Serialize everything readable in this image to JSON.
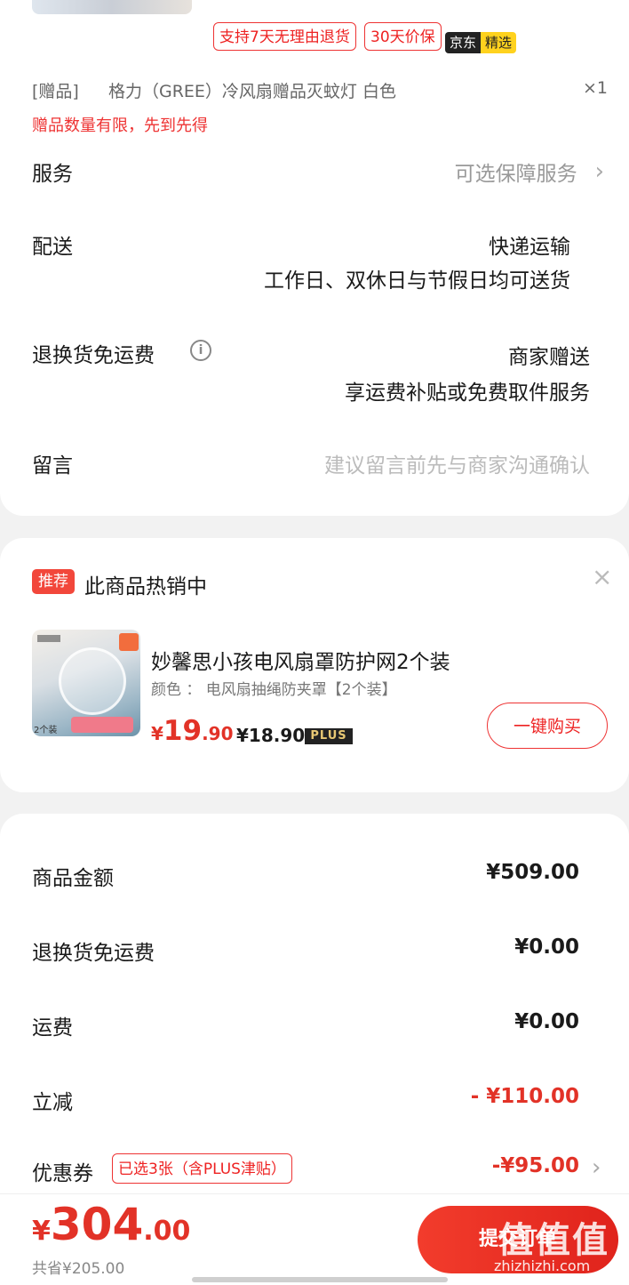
{
  "product": {
    "tags": [
      "支持7天无理由退货",
      "30天价保"
    ],
    "jd_badge": {
      "part1": "京东",
      "part2": "精选"
    },
    "gift": {
      "prefix": "[赠品]",
      "name": "格力（GREE）冷风扇赠品灭蚊灯  白色",
      "qty": "×1",
      "note": "赠品数量有限，先到先得"
    }
  },
  "rows": {
    "service": {
      "label": "服务",
      "value": "可选保障服务"
    },
    "delivery": {
      "label": "配送",
      "value": "快递运输",
      "sub": "工作日、双休日与节假日均可送货"
    },
    "return_freight": {
      "label": "退换货免运费",
      "value": "商家赠送",
      "sub": "享运费补贴或免费取件服务"
    },
    "message": {
      "label": "留言",
      "placeholder": "建议留言前先与商家沟通确认"
    }
  },
  "recommend": {
    "badge": "推荐",
    "title": "此商品热销中",
    "item": {
      "name": "妙馨思小孩电风扇罩防护网2个装",
      "spec": "颜色 ：  电风扇抽绳防夹罩【2个装】",
      "price_symbol": "¥",
      "price_int": "19",
      "price_dec": ".90",
      "plus_price": "¥18.90",
      "plus_label": "PLUS",
      "image_tag": "2个装"
    },
    "buy_button": "一键购买"
  },
  "summary": {
    "goods_amount": {
      "label": "商品金额",
      "value": "¥509.00"
    },
    "return_freight": {
      "label": "退换货免运费",
      "value": "¥0.00"
    },
    "freight": {
      "label": "运费",
      "value": "¥0.00"
    },
    "discount": {
      "label": "立减",
      "value": "- ¥110.00"
    },
    "coupon": {
      "label": "优惠券",
      "chip": "已选3张（含PLUS津贴）",
      "value": "-¥95.00"
    }
  },
  "bottom": {
    "currency": "¥",
    "total_int": "304",
    "total_dec": ".00",
    "saved": "共省¥205.00",
    "submit": "提交订单",
    "watermark": "值值值",
    "watermark_url": "zhizhizhi.com"
  },
  "colors": {
    "accent": "#e23227",
    "plus_bg": "#222222",
    "jd_yellow": "#ffd21e"
  }
}
